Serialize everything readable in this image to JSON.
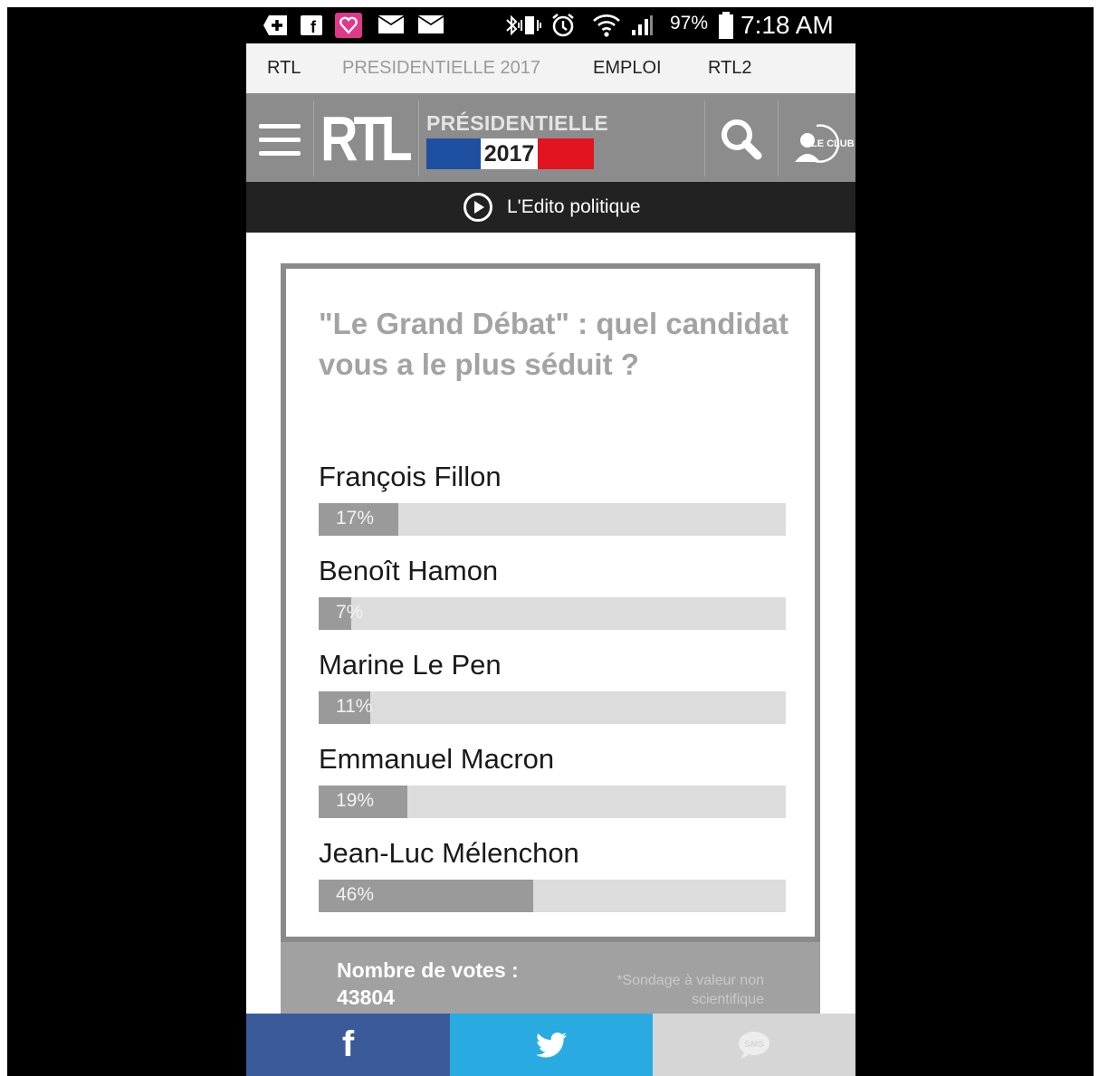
{
  "status_bar": {
    "battery": "97%",
    "time": "7:18 AM",
    "icons": [
      "plus-box-icon",
      "facebook-notification-icon",
      "app-heart-icon",
      "mail-icon",
      "mail-icon",
      "bluetooth-icon",
      "vibrate-icon",
      "alarm-icon",
      "wifi-icon",
      "signal-icon",
      "battery-icon"
    ]
  },
  "top_nav": {
    "items": [
      "RTL",
      "PRESIDENTIELLE 2017",
      "EMPLOI",
      "RTL2"
    ]
  },
  "header": {
    "logo": "RTL",
    "section_label": "PRÉSIDENTIELLE",
    "section_year": "2017",
    "club_label": "LE CLUB",
    "icons": [
      "menu-icon",
      "search-icon",
      "le-club-icon"
    ]
  },
  "edito": {
    "label": "L'Edito politique"
  },
  "poll": {
    "title": "\"Le Grand Débat\" : quel candidat vous a le plus séduit ?",
    "candidates": [
      {
        "name": "François Fillon",
        "percent_label": "17%",
        "value": 17
      },
      {
        "name": "Benoît Hamon",
        "percent_label": "7%",
        "value": 7
      },
      {
        "name": "Marine Le Pen",
        "percent_label": "11%",
        "value": 11
      },
      {
        "name": "Emmanuel Macron",
        "percent_label": "19%",
        "value": 19
      },
      {
        "name": "Jean-Luc Mélenchon",
        "percent_label": "46%",
        "value": 46
      }
    ],
    "votes_label": "Nombre de votes :",
    "votes_count": "43804",
    "disclaimer": "*Sondage à valeur non scientifique"
  },
  "share": {
    "facebook_glyph": "f",
    "sms_label": "SMS",
    "colors": {
      "facebook": "#3b5a9a",
      "twitter": "#29abe2",
      "sms": "#d6d6d6"
    }
  },
  "colors": {
    "header_bg": "#8c8c8c",
    "edito_bg": "#222222",
    "flag_blue": "#1f4fa0",
    "flag_red": "#e2141f",
    "poll_border": "#8a8a8a"
  }
}
